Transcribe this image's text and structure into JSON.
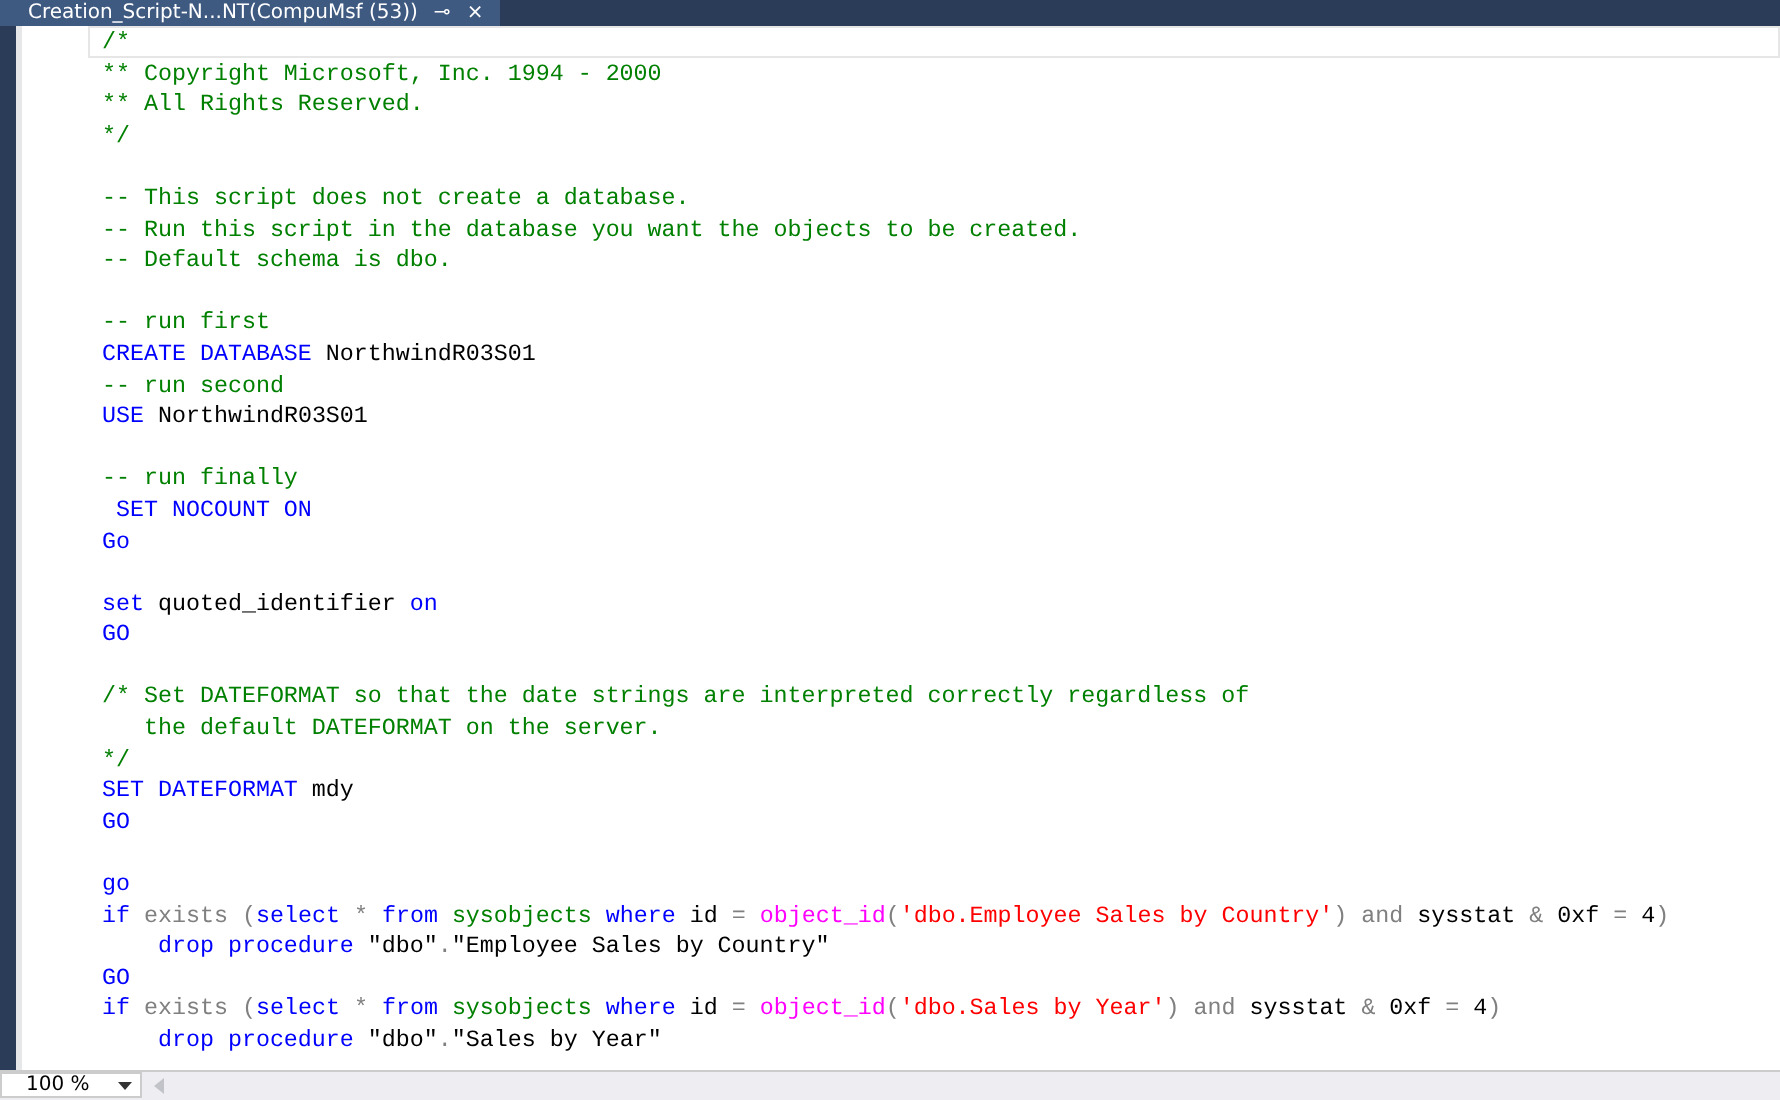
{
  "tab": {
    "title": "Creation_Script-N...NT(CompuMsf (53))",
    "pin": "⊸",
    "close": "×"
  },
  "lines": [
    {
      "current": true,
      "tokens": [
        {
          "kind": "c",
          "text": "/*"
        }
      ]
    },
    {
      "current": false,
      "tokens": [
        {
          "kind": "c",
          "text": "** Copyright Microsoft, Inc. 1994 - 2000"
        }
      ]
    },
    {
      "current": false,
      "tokens": [
        {
          "kind": "c",
          "text": "** All Rights Reserved."
        }
      ]
    },
    {
      "current": false,
      "tokens": [
        {
          "kind": "c",
          "text": "*/"
        }
      ]
    },
    {
      "current": false
    },
    {
      "current": false,
      "tokens": [
        {
          "kind": "c",
          "text": "-- This script does not create a database."
        }
      ]
    },
    {
      "current": false,
      "tokens": [
        {
          "kind": "c",
          "text": "-- Run this script in the database you want the objects to be created."
        }
      ]
    },
    {
      "current": false,
      "tokens": [
        {
          "kind": "c",
          "text": "-- Default schema is dbo."
        }
      ]
    },
    {
      "current": false
    },
    {
      "current": false,
      "tokens": [
        {
          "kind": "c",
          "text": "-- run first"
        }
      ]
    },
    {
      "current": false,
      "tokens": [
        {
          "kind": "k",
          "text": "CREATE DATABASE"
        },
        {
          "kind": "p",
          "text": " NorthwindR03S01"
        }
      ]
    },
    {
      "current": false,
      "tokens": [
        {
          "kind": "c",
          "text": "-- run second"
        }
      ]
    },
    {
      "current": false,
      "tokens": [
        {
          "kind": "k",
          "text": "USE"
        },
        {
          "kind": "p",
          "text": " NorthwindR03S01"
        }
      ]
    },
    {
      "current": false
    },
    {
      "current": false,
      "tokens": [
        {
          "kind": "c",
          "text": "-- run finally"
        }
      ]
    },
    {
      "current": false,
      "tokens": [
        {
          "kind": "k",
          "text": " SET NOCOUNT ON"
        }
      ]
    },
    {
      "current": false,
      "tokens": [
        {
          "kind": "k",
          "text": "Go"
        }
      ]
    },
    {
      "current": false
    },
    {
      "current": false,
      "tokens": [
        {
          "kind": "k",
          "text": "set"
        },
        {
          "kind": "p",
          "text": " quoted_identifier "
        },
        {
          "kind": "k",
          "text": "on"
        }
      ]
    },
    {
      "current": false,
      "tokens": [
        {
          "kind": "k",
          "text": "GO"
        }
      ]
    },
    {
      "current": false
    },
    {
      "current": false,
      "tokens": [
        {
          "kind": "c",
          "text": "/* Set DATEFORMAT so that the date strings are interpreted correctly regardless of"
        }
      ]
    },
    {
      "current": false,
      "tokens": [
        {
          "kind": "c",
          "text": "   the default DATEFORMAT on the server."
        }
      ]
    },
    {
      "current": false,
      "tokens": [
        {
          "kind": "c",
          "text": "*/"
        }
      ]
    },
    {
      "current": false,
      "tokens": [
        {
          "kind": "k",
          "text": "SET DATEFORMAT"
        },
        {
          "kind": "p",
          "text": " mdy"
        }
      ]
    },
    {
      "current": false,
      "tokens": [
        {
          "kind": "k",
          "text": "GO"
        }
      ]
    },
    {
      "current": false
    },
    {
      "current": false,
      "tokens": [
        {
          "kind": "k",
          "text": "go"
        }
      ]
    },
    {
      "current": false,
      "tokens": [
        {
          "kind": "k",
          "text": "if"
        },
        {
          "kind": "o",
          "text": " exists ("
        },
        {
          "kind": "k",
          "text": "select"
        },
        {
          "kind": "o",
          "text": " * "
        },
        {
          "kind": "k",
          "text": "from "
        },
        {
          "kind": "y",
          "text": "sysobjects"
        },
        {
          "kind": "k",
          "text": " where"
        },
        {
          "kind": "p",
          "text": " id "
        },
        {
          "kind": "o",
          "text": "= "
        },
        {
          "kind": "f",
          "text": "object_id"
        },
        {
          "kind": "o",
          "text": "("
        },
        {
          "kind": "s",
          "text": "'dbo.Employee Sales by Country'"
        },
        {
          "kind": "o",
          "text": ") and"
        },
        {
          "kind": "p",
          "text": " sysstat "
        },
        {
          "kind": "o",
          "text": "&"
        },
        {
          "kind": "p",
          "text": " 0xf "
        },
        {
          "kind": "o",
          "text": "="
        },
        {
          "kind": "p",
          "text": " 4"
        },
        {
          "kind": "o",
          "text": ")"
        }
      ]
    },
    {
      "current": false,
      "tokens": [
        {
          "kind": "k",
          "text": "    drop procedure"
        },
        {
          "kind": "p",
          "text": " \"dbo\""
        },
        {
          "kind": "o",
          "text": "."
        },
        {
          "kind": "p",
          "text": "\"Employee Sales by Country\""
        }
      ]
    },
    {
      "current": false,
      "tokens": [
        {
          "kind": "k",
          "text": "GO"
        }
      ]
    },
    {
      "current": false,
      "tokens": [
        {
          "kind": "k",
          "text": "if"
        },
        {
          "kind": "o",
          "text": " exists ("
        },
        {
          "kind": "k",
          "text": "select"
        },
        {
          "kind": "o",
          "text": " * "
        },
        {
          "kind": "k",
          "text": "from "
        },
        {
          "kind": "y",
          "text": "sysobjects"
        },
        {
          "kind": "k",
          "text": " where"
        },
        {
          "kind": "p",
          "text": " id "
        },
        {
          "kind": "o",
          "text": "= "
        },
        {
          "kind": "f",
          "text": "object_id"
        },
        {
          "kind": "o",
          "text": "("
        },
        {
          "kind": "s",
          "text": "'dbo.Sales by Year'"
        },
        {
          "kind": "o",
          "text": ") and"
        },
        {
          "kind": "p",
          "text": " sysstat "
        },
        {
          "kind": "o",
          "text": "&"
        },
        {
          "kind": "p",
          "text": " 0xf "
        },
        {
          "kind": "o",
          "text": "="
        },
        {
          "kind": "p",
          "text": " 4"
        },
        {
          "kind": "o",
          "text": ")"
        }
      ]
    },
    {
      "current": false,
      "tokens": [
        {
          "kind": "k",
          "text": "    drop procedure"
        },
        {
          "kind": "p",
          "text": " \"dbo\""
        },
        {
          "kind": "o",
          "text": "."
        },
        {
          "kind": "p",
          "text": "\"Sales by Year\""
        }
      ]
    }
  ],
  "zoom": {
    "value": "100 %"
  }
}
